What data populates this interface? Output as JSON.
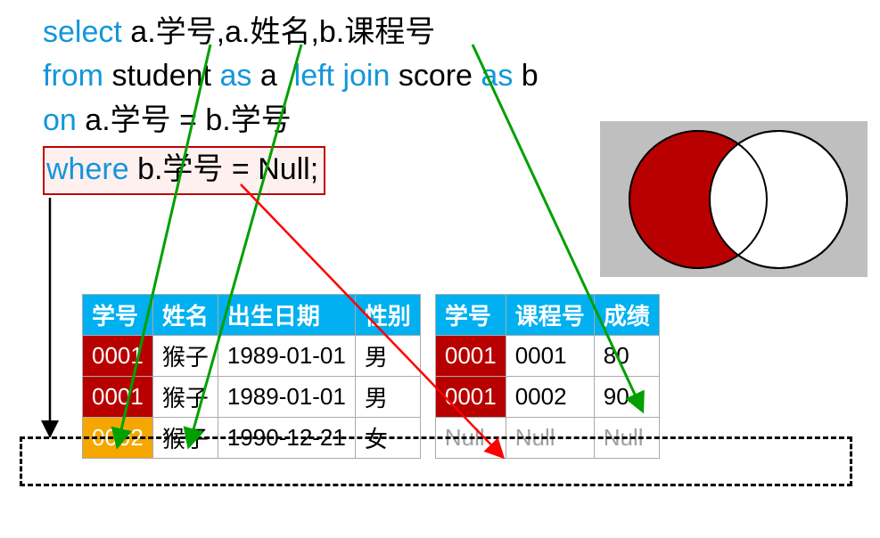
{
  "sql": {
    "select": "select",
    "cols": "a.学号,a.姓名,b.课程号",
    "from": "from",
    "table1": "student",
    "as1": "as",
    "alias1": "a",
    "join": "left join",
    "table2": "score",
    "as2": "as",
    "alias2": "b",
    "on": "on",
    "on_cond": "a.学号 = b.学号",
    "where": "where",
    "where_cond": "b.学号 = Null;"
  },
  "student_table": {
    "headers": [
      "学号",
      "姓名",
      "出生日期",
      "性别"
    ],
    "rows": [
      {
        "id": "0001",
        "name": "猴子",
        "dob": "1989-01-01",
        "sex": "男",
        "id_style": "red"
      },
      {
        "id": "0001",
        "name": "猴子",
        "dob": "1989-01-01",
        "sex": "男",
        "id_style": "red"
      },
      {
        "id": "0002",
        "name": "猴子",
        "dob": "1990-12-21",
        "sex": "女",
        "id_style": "orange"
      }
    ]
  },
  "score_table": {
    "headers": [
      "学号",
      "课程号",
      "成绩"
    ],
    "rows": [
      {
        "id": "0001",
        "course": "0001",
        "score": "80",
        "id_style": "red",
        "null_row": false
      },
      {
        "id": "0001",
        "course": "0002",
        "score": "90",
        "id_style": "red",
        "null_row": false
      },
      {
        "id": "Null",
        "course": "Null",
        "score": "Null",
        "id_style": "",
        "null_row": true
      }
    ]
  },
  "colors": {
    "keyword": "#1296db",
    "red_cell": "#b80000",
    "orange_cell": "#f5a700",
    "header": "#00b0f0",
    "venn_fill": "#b80000",
    "where_border": "#c00000"
  }
}
